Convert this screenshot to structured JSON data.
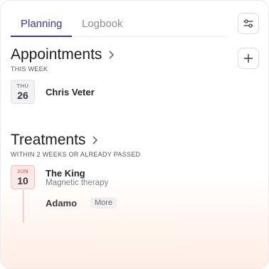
{
  "tabs": [
    {
      "label": "Planning",
      "active": true
    },
    {
      "label": "Logbook",
      "active": false
    }
  ],
  "icons": {
    "filter": "sliders-icon",
    "add": "plus-icon",
    "chevron": "chevron-right-icon"
  },
  "colors": {
    "accent": "#3d35a0",
    "alert": "#d0494f"
  },
  "appointments": {
    "title": "Appointments",
    "subtitle": "THIS WEEK",
    "items": [
      {
        "dow": "THU",
        "day": "26",
        "name": "Chris Veter"
      }
    ]
  },
  "treatments": {
    "title": "Treatments",
    "subtitle": "WITHIN 2 WEEKS OR ALREADY PASSED",
    "items": [
      {
        "month": "JUN",
        "day": "10",
        "name": "The King",
        "treatment": "Magnetic therapy"
      }
    ],
    "next": {
      "name": "Adamo",
      "more_label": "More"
    }
  }
}
